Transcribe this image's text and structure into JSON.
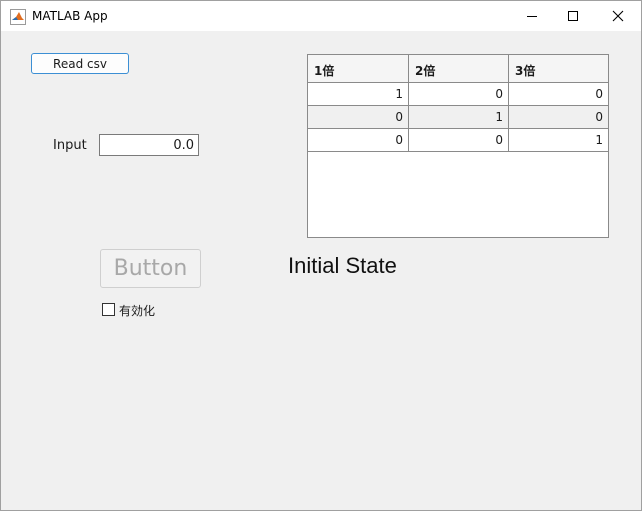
{
  "window": {
    "title": "MATLAB App",
    "icon": "matlab-logo-icon",
    "controls": [
      "minimize-icon",
      "maximize-icon",
      "close-icon"
    ]
  },
  "read_button": {
    "label": "Read csv"
  },
  "input": {
    "label": "Input",
    "value": "0.0"
  },
  "table": {
    "columns": [
      "1倍",
      "2倍",
      "3倍"
    ],
    "rows": [
      [
        "1",
        "0",
        "0"
      ],
      [
        "0",
        "1",
        "0"
      ],
      [
        "0",
        "0",
        "1"
      ]
    ]
  },
  "action_button": {
    "label": "Button",
    "enabled": false
  },
  "state_label": {
    "text": "Initial State"
  },
  "enable_checkbox": {
    "label": "有効化",
    "checked": false
  },
  "colors": {
    "accent": "#3c8fd4",
    "background": "#f0f0f0"
  }
}
